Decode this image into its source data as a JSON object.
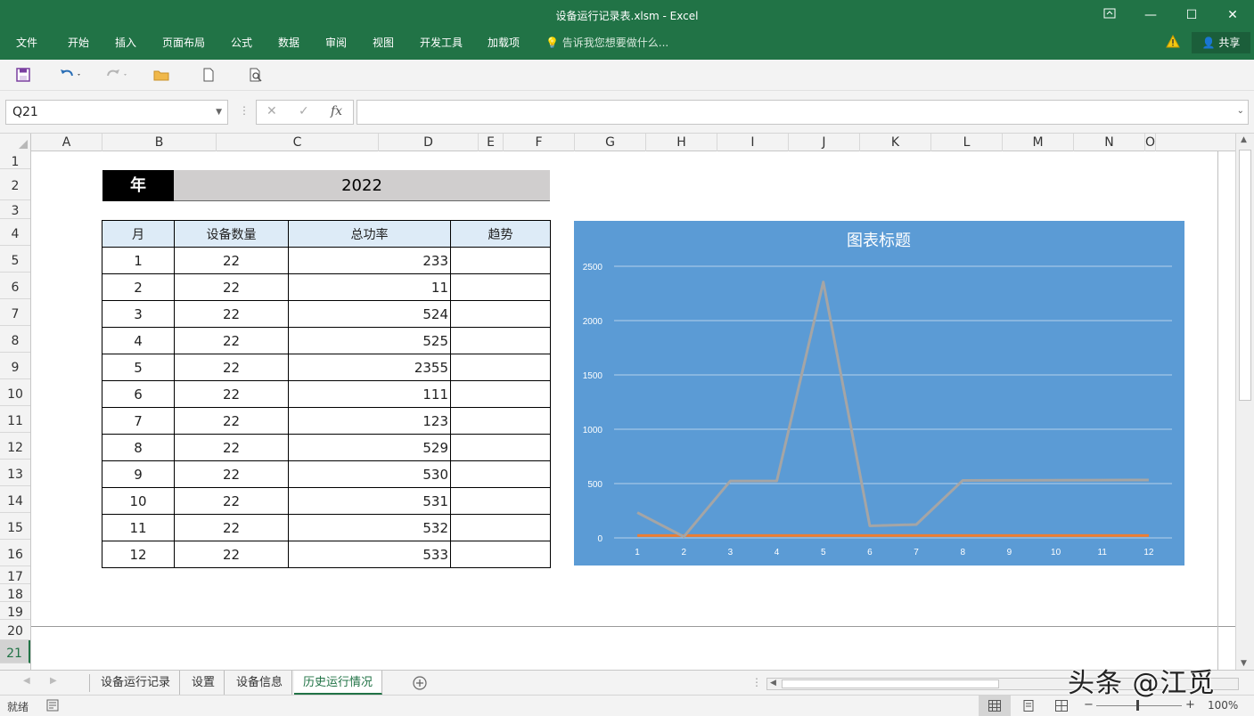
{
  "window": {
    "title": "设备运行记录表.xlsm - Excel"
  },
  "ribbon": {
    "tabs": [
      "文件",
      "开始",
      "插入",
      "页面布局",
      "公式",
      "数据",
      "审阅",
      "视图",
      "开发工具",
      "加载项"
    ],
    "tell_me": "告诉我您想要做什么...",
    "share": "共享"
  },
  "formula_bar": {
    "name_box": "Q21",
    "fx": "fx",
    "value": ""
  },
  "grid": {
    "columns": [
      "A",
      "B",
      "C",
      "D",
      "E",
      "F",
      "G",
      "H",
      "I",
      "J",
      "K",
      "L",
      "M",
      "N",
      "O"
    ],
    "rows": [
      "1",
      "2",
      "3",
      "4",
      "5",
      "6",
      "7",
      "8",
      "9",
      "10",
      "11",
      "12",
      "13",
      "14",
      "15",
      "16",
      "17",
      "18",
      "19",
      "20",
      "21"
    ],
    "selected_row": "21"
  },
  "year_block": {
    "label": "年",
    "value": "2022"
  },
  "table": {
    "headers": [
      "月",
      "设备数量",
      "总功率",
      "趋势"
    ],
    "rows": [
      [
        "1",
        "22",
        "233",
        ""
      ],
      [
        "2",
        "22",
        "11",
        ""
      ],
      [
        "3",
        "22",
        "524",
        ""
      ],
      [
        "4",
        "22",
        "525",
        ""
      ],
      [
        "5",
        "22",
        "2355",
        ""
      ],
      [
        "6",
        "22",
        "111",
        ""
      ],
      [
        "7",
        "22",
        "123",
        ""
      ],
      [
        "8",
        "22",
        "529",
        ""
      ],
      [
        "9",
        "22",
        "530",
        ""
      ],
      [
        "10",
        "22",
        "531",
        ""
      ],
      [
        "11",
        "22",
        "532",
        ""
      ],
      [
        "12",
        "22",
        "533",
        ""
      ]
    ]
  },
  "chart_data": {
    "type": "line",
    "title": "图表标题",
    "categories": [
      "1",
      "2",
      "3",
      "4",
      "5",
      "6",
      "7",
      "8",
      "9",
      "10",
      "11",
      "12"
    ],
    "series": [
      {
        "values": [
          22,
          22,
          22,
          22,
          22,
          22,
          22,
          22,
          22,
          22,
          22,
          22
        ],
        "color": "#ed7d31"
      },
      {
        "values": [
          233,
          11,
          524,
          525,
          2355,
          111,
          123,
          529,
          530,
          531,
          532,
          533
        ],
        "color": "#a5a5a5"
      }
    ],
    "yticks": [
      "0",
      "500",
      "1000",
      "1500",
      "2000",
      "2500"
    ],
    "ylim": [
      0,
      2500
    ],
    "grid": true,
    "background": "#5b9bd5"
  },
  "sheet_tabs": {
    "tabs": [
      "设备运行记录",
      "设置",
      "设备信息",
      "历史运行情况"
    ],
    "active": "历史运行情况"
  },
  "status": {
    "ready": "就绪",
    "zoom": "100%"
  },
  "watermark": "头条 @江觅",
  "colors": {
    "accent": "#217346",
    "table_header": "#ddebf7",
    "year_bg": "#d0cece"
  }
}
